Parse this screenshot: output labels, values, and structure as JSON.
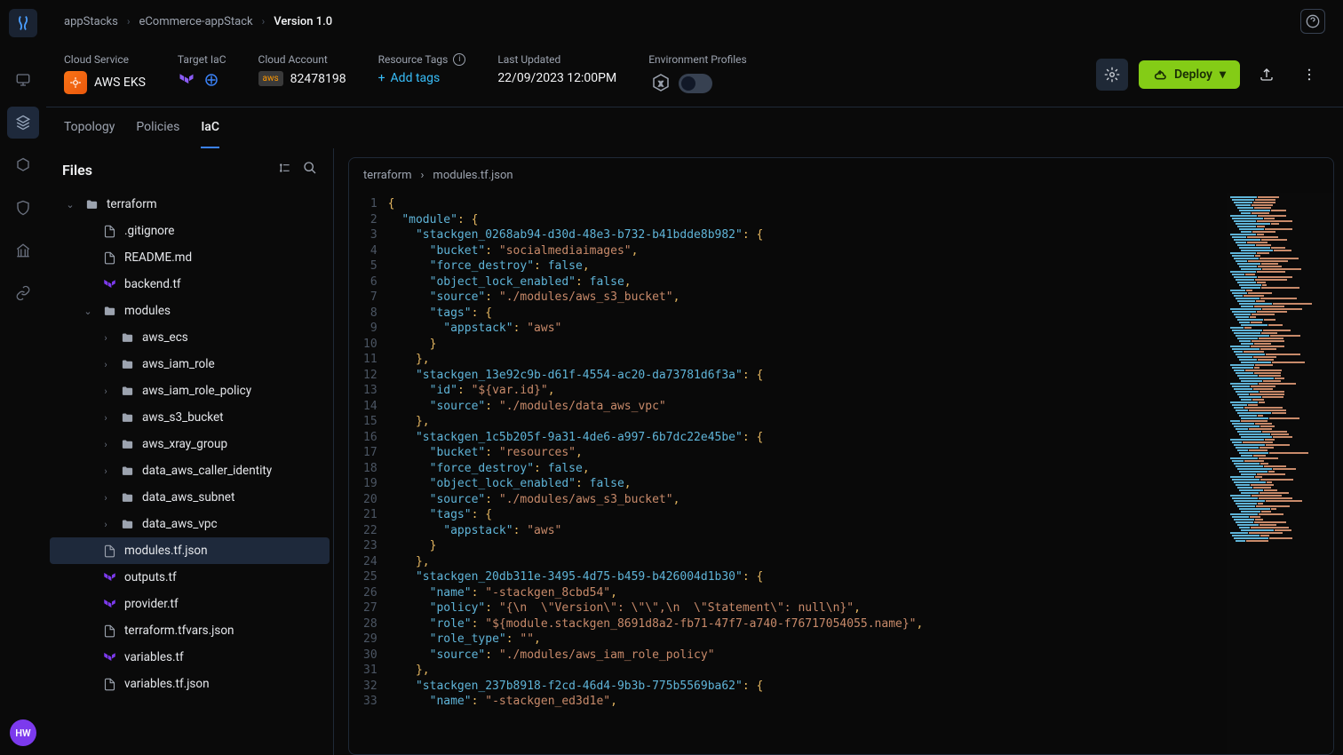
{
  "breadcrumb": {
    "items": [
      "appStacks",
      "eCommerce-appStack",
      "Version 1.0"
    ]
  },
  "meta": {
    "cloud_service": {
      "label": "Cloud Service",
      "value": "AWS EKS"
    },
    "target_iac": {
      "label": "Target IaC"
    },
    "cloud_account": {
      "label": "Cloud Account",
      "value": "82478198",
      "aws": "aws"
    },
    "resource_tags": {
      "label": "Resource Tags",
      "add": "Add tags"
    },
    "last_updated": {
      "label": "Last Updated",
      "value": "22/09/2023 12:00PM"
    },
    "env_profiles": {
      "label": "Environment Profiles"
    }
  },
  "deploy_label": "Deploy",
  "tabs": [
    "Topology",
    "Policies",
    "IaC"
  ],
  "files": {
    "title": "Files",
    "tree": {
      "root": "terraform",
      "items": [
        {
          "name": ".gitignore",
          "type": "file"
        },
        {
          "name": "README.md",
          "type": "file"
        },
        {
          "name": "backend.tf",
          "type": "tf"
        }
      ],
      "modules": {
        "name": "modules",
        "items": [
          "aws_ecs",
          "aws_iam_role",
          "aws_iam_role_policy",
          "aws_s3_bucket",
          "aws_xray_group",
          "data_aws_caller_identity",
          "data_aws_subnet",
          "data_aws_vpc"
        ]
      },
      "rest": [
        {
          "name": "modules.tf.json",
          "type": "file",
          "selected": true
        },
        {
          "name": "outputs.tf",
          "type": "tf"
        },
        {
          "name": "provider.tf",
          "type": "tf"
        },
        {
          "name": "terraform.tfvars.json",
          "type": "file"
        },
        {
          "name": "variables.tf",
          "type": "tf"
        },
        {
          "name": "variables.tf.json",
          "type": "file"
        }
      ]
    }
  },
  "editor": {
    "breadcrumb": [
      "terraform",
      "modules.tf.json"
    ],
    "lines": [
      [
        {
          "t": "brace",
          "v": "{"
        }
      ],
      [
        {
          "t": "ind",
          "v": "  "
        },
        {
          "t": "key",
          "v": "\"module\""
        },
        {
          "t": "punc",
          "v": ": "
        },
        {
          "t": "brace",
          "v": "{"
        }
      ],
      [
        {
          "t": "ind",
          "v": "    "
        },
        {
          "t": "key",
          "v": "\"stackgen_0268ab94-d30d-48e3-b732-b41bdde8b982\""
        },
        {
          "t": "punc",
          "v": ": "
        },
        {
          "t": "brace",
          "v": "{"
        }
      ],
      [
        {
          "t": "ind",
          "v": "      "
        },
        {
          "t": "key",
          "v": "\"bucket\""
        },
        {
          "t": "punc",
          "v": ": "
        },
        {
          "t": "str",
          "v": "\"socialmediaimages\""
        },
        {
          "t": "punc",
          "v": ","
        }
      ],
      [
        {
          "t": "ind",
          "v": "      "
        },
        {
          "t": "key",
          "v": "\"force_destroy\""
        },
        {
          "t": "punc",
          "v": ": "
        },
        {
          "t": "bool",
          "v": "false"
        },
        {
          "t": "punc",
          "v": ","
        }
      ],
      [
        {
          "t": "ind",
          "v": "      "
        },
        {
          "t": "key",
          "v": "\"object_lock_enabled\""
        },
        {
          "t": "punc",
          "v": ": "
        },
        {
          "t": "bool",
          "v": "false"
        },
        {
          "t": "punc",
          "v": ","
        }
      ],
      [
        {
          "t": "ind",
          "v": "      "
        },
        {
          "t": "key",
          "v": "\"source\""
        },
        {
          "t": "punc",
          "v": ": "
        },
        {
          "t": "str",
          "v": "\"./modules/aws_s3_bucket\""
        },
        {
          "t": "punc",
          "v": ","
        }
      ],
      [
        {
          "t": "ind",
          "v": "      "
        },
        {
          "t": "key",
          "v": "\"tags\""
        },
        {
          "t": "punc",
          "v": ": "
        },
        {
          "t": "brace",
          "v": "{"
        }
      ],
      [
        {
          "t": "ind",
          "v": "        "
        },
        {
          "t": "key",
          "v": "\"appstack\""
        },
        {
          "t": "punc",
          "v": ": "
        },
        {
          "t": "str",
          "v": "\"aws\""
        }
      ],
      [
        {
          "t": "ind",
          "v": "      "
        },
        {
          "t": "brace",
          "v": "}"
        }
      ],
      [
        {
          "t": "ind",
          "v": "    "
        },
        {
          "t": "brace",
          "v": "}"
        },
        {
          "t": "punc",
          "v": ","
        }
      ],
      [
        {
          "t": "ind",
          "v": "    "
        },
        {
          "t": "key",
          "v": "\"stackgen_13e92c9b-d61f-4554-ac20-da73781d6f3a\""
        },
        {
          "t": "punc",
          "v": ": "
        },
        {
          "t": "brace",
          "v": "{"
        }
      ],
      [
        {
          "t": "ind",
          "v": "      "
        },
        {
          "t": "key",
          "v": "\"id\""
        },
        {
          "t": "punc",
          "v": ": "
        },
        {
          "t": "str",
          "v": "\"${var.id}\""
        },
        {
          "t": "punc",
          "v": ","
        }
      ],
      [
        {
          "t": "ind",
          "v": "      "
        },
        {
          "t": "key",
          "v": "\"source\""
        },
        {
          "t": "punc",
          "v": ": "
        },
        {
          "t": "str",
          "v": "\"./modules/data_aws_vpc\""
        }
      ],
      [
        {
          "t": "ind",
          "v": "    "
        },
        {
          "t": "brace",
          "v": "}"
        },
        {
          "t": "punc",
          "v": ","
        }
      ],
      [
        {
          "t": "ind",
          "v": "    "
        },
        {
          "t": "key",
          "v": "\"stackgen_1c5b205f-9a31-4de6-a997-6b7dc22e45be\""
        },
        {
          "t": "punc",
          "v": ": "
        },
        {
          "t": "brace",
          "v": "{"
        }
      ],
      [
        {
          "t": "ind",
          "v": "      "
        },
        {
          "t": "key",
          "v": "\"bucket\""
        },
        {
          "t": "punc",
          "v": ": "
        },
        {
          "t": "str",
          "v": "\"resources\""
        },
        {
          "t": "punc",
          "v": ","
        }
      ],
      [
        {
          "t": "ind",
          "v": "      "
        },
        {
          "t": "key",
          "v": "\"force_destroy\""
        },
        {
          "t": "punc",
          "v": ": "
        },
        {
          "t": "bool",
          "v": "false"
        },
        {
          "t": "punc",
          "v": ","
        }
      ],
      [
        {
          "t": "ind",
          "v": "      "
        },
        {
          "t": "key",
          "v": "\"object_lock_enabled\""
        },
        {
          "t": "punc",
          "v": ": "
        },
        {
          "t": "bool",
          "v": "false"
        },
        {
          "t": "punc",
          "v": ","
        }
      ],
      [
        {
          "t": "ind",
          "v": "      "
        },
        {
          "t": "key",
          "v": "\"source\""
        },
        {
          "t": "punc",
          "v": ": "
        },
        {
          "t": "str",
          "v": "\"./modules/aws_s3_bucket\""
        },
        {
          "t": "punc",
          "v": ","
        }
      ],
      [
        {
          "t": "ind",
          "v": "      "
        },
        {
          "t": "key",
          "v": "\"tags\""
        },
        {
          "t": "punc",
          "v": ": "
        },
        {
          "t": "brace",
          "v": "{"
        }
      ],
      [
        {
          "t": "ind",
          "v": "        "
        },
        {
          "t": "key",
          "v": "\"appstack\""
        },
        {
          "t": "punc",
          "v": ": "
        },
        {
          "t": "str",
          "v": "\"aws\""
        }
      ],
      [
        {
          "t": "ind",
          "v": "      "
        },
        {
          "t": "brace",
          "v": "}"
        }
      ],
      [
        {
          "t": "ind",
          "v": "    "
        },
        {
          "t": "brace",
          "v": "}"
        },
        {
          "t": "punc",
          "v": ","
        }
      ],
      [
        {
          "t": "ind",
          "v": "    "
        },
        {
          "t": "key",
          "v": "\"stackgen_20db311e-3495-4d75-b459-b426004d1b30\""
        },
        {
          "t": "punc",
          "v": ": "
        },
        {
          "t": "brace",
          "v": "{"
        }
      ],
      [
        {
          "t": "ind",
          "v": "      "
        },
        {
          "t": "key",
          "v": "\"name\""
        },
        {
          "t": "punc",
          "v": ": "
        },
        {
          "t": "str",
          "v": "\"-stackgen_8cbd54\""
        },
        {
          "t": "punc",
          "v": ","
        }
      ],
      [
        {
          "t": "ind",
          "v": "      "
        },
        {
          "t": "key",
          "v": "\"policy\""
        },
        {
          "t": "punc",
          "v": ": "
        },
        {
          "t": "str",
          "v": "\"{\\n  \\\"Version\\\": \\\"\\\",\\n  \\\"Statement\\\": null\\n}\""
        },
        {
          "t": "punc",
          "v": ","
        }
      ],
      [
        {
          "t": "ind",
          "v": "      "
        },
        {
          "t": "key",
          "v": "\"role\""
        },
        {
          "t": "punc",
          "v": ": "
        },
        {
          "t": "str",
          "v": "\"${module.stackgen_8691d8a2-fb71-47f7-a740-f76717054055.name}\""
        },
        {
          "t": "punc",
          "v": ","
        }
      ],
      [
        {
          "t": "ind",
          "v": "      "
        },
        {
          "t": "key",
          "v": "\"role_type\""
        },
        {
          "t": "punc",
          "v": ": "
        },
        {
          "t": "str",
          "v": "\"\""
        },
        {
          "t": "punc",
          "v": ","
        }
      ],
      [
        {
          "t": "ind",
          "v": "      "
        },
        {
          "t": "key",
          "v": "\"source\""
        },
        {
          "t": "punc",
          "v": ": "
        },
        {
          "t": "str",
          "v": "\"./modules/aws_iam_role_policy\""
        }
      ],
      [
        {
          "t": "ind",
          "v": "    "
        },
        {
          "t": "brace",
          "v": "}"
        },
        {
          "t": "punc",
          "v": ","
        }
      ],
      [
        {
          "t": "ind",
          "v": "    "
        },
        {
          "t": "key",
          "v": "\"stackgen_237b8918-f2cd-46d4-9b3b-775b5569ba62\""
        },
        {
          "t": "punc",
          "v": ": "
        },
        {
          "t": "brace",
          "v": "{"
        }
      ],
      [
        {
          "t": "ind",
          "v": "      "
        },
        {
          "t": "key",
          "v": "\"name\""
        },
        {
          "t": "punc",
          "v": ": "
        },
        {
          "t": "str",
          "v": "\"-stackgen_ed3d1e\""
        },
        {
          "t": "punc",
          "v": ","
        }
      ]
    ]
  },
  "avatar": "HW"
}
